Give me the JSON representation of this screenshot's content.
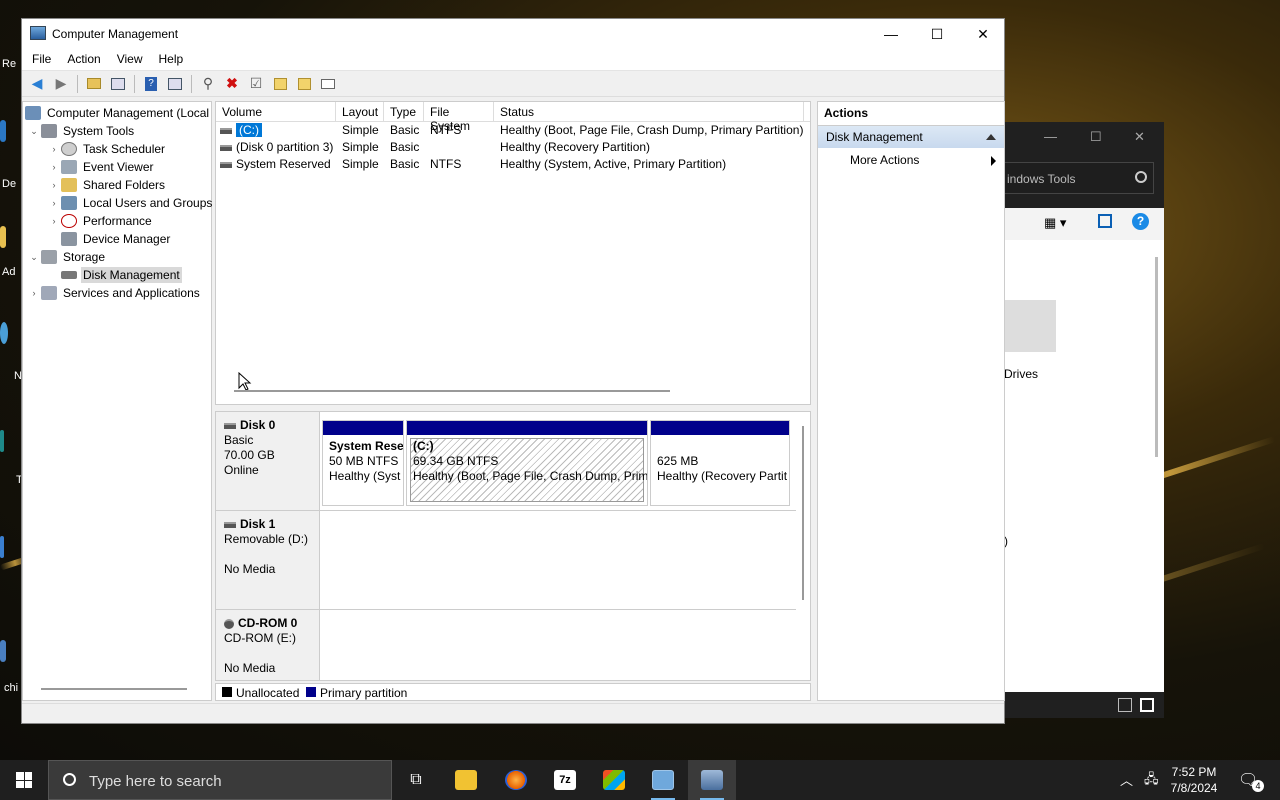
{
  "window": {
    "title": "Computer Management",
    "controls": {
      "minimize": "—",
      "maximize": "☐",
      "close": "✕"
    }
  },
  "menu": [
    "File",
    "Action",
    "View",
    "Help"
  ],
  "tree": {
    "root": "Computer Management (Local",
    "system_tools": "System Tools",
    "task_scheduler": "Task Scheduler",
    "event_viewer": "Event Viewer",
    "shared_folders": "Shared Folders",
    "local_users": "Local Users and Groups",
    "performance": "Performance",
    "device_manager": "Device Manager",
    "storage": "Storage",
    "disk_management": "Disk Management",
    "services": "Services and Applications"
  },
  "volume_list": {
    "columns": [
      "Volume",
      "Layout",
      "Type",
      "File System",
      "Status"
    ],
    "rows": [
      {
        "volume": "(C:)",
        "layout": "Simple",
        "type": "Basic",
        "fs": "NTFS",
        "status": "Healthy (Boot, Page File, Crash Dump, Primary Partition)"
      },
      {
        "volume": "(Disk 0 partition 3)",
        "layout": "Simple",
        "type": "Basic",
        "fs": "",
        "status": "Healthy (Recovery Partition)"
      },
      {
        "volume": "System Reserved",
        "layout": "Simple",
        "type": "Basic",
        "fs": "NTFS",
        "status": "Healthy (System, Active, Primary Partition)"
      }
    ]
  },
  "disks": {
    "disk0": {
      "name": "Disk 0",
      "type": "Basic",
      "size": "70.00 GB",
      "state": "Online",
      "partitions": [
        {
          "title": "System Rese",
          "size": "50 MB NTFS",
          "status": "Healthy (Syst"
        },
        {
          "title": "(C:)",
          "size": "69.34 GB NTFS",
          "status": "Healthy (Boot, Page File, Crash Dump, Prim"
        },
        {
          "title": "",
          "size": "625 MB",
          "status": "Healthy (Recovery Partit"
        }
      ]
    },
    "disk1": {
      "name": "Disk 1",
      "type": "Removable (D:)",
      "state": "No Media"
    },
    "cdrom0": {
      "name": "CD-ROM 0",
      "type": "CD-ROM (E:)",
      "state": "No Media"
    }
  },
  "legend": {
    "unallocated": "Unallocated",
    "primary": "Primary partition"
  },
  "actions": {
    "header": "Actions",
    "section": "Disk Management",
    "more": "More Actions"
  },
  "background_window": {
    "search_text": "indows Tools",
    "drives_text": "Drives",
    "paren_text": ")"
  },
  "desktop_labels": [
    "Re",
    "De",
    "Ad",
    "N",
    "T",
    "chi"
  ],
  "taskbar": {
    "search_placeholder": "Type here to search",
    "time": "7:52 PM",
    "date": "7/8/2024",
    "notification_count": "4"
  },
  "colors": {
    "primary_partition": "#00008b",
    "unallocated": "#000000",
    "selection": "#0078d7"
  }
}
